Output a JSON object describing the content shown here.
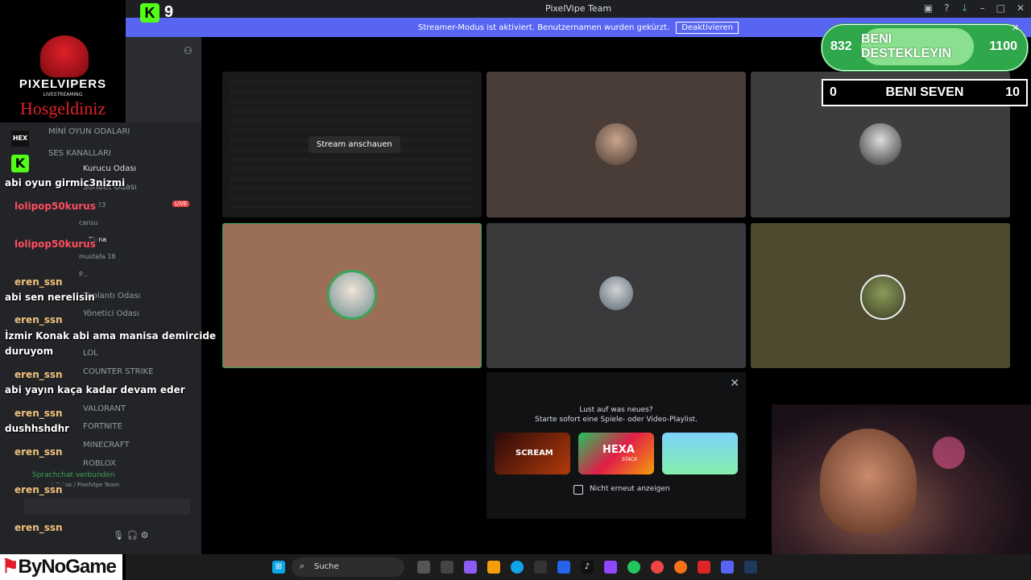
{
  "window": {
    "title": "PixelVipe Team",
    "banner_text": "Streamer-Modus ist aktiviert. Benutzernamen wurden gekürzt.",
    "banner_button": "Deaktivieren"
  },
  "overlay": {
    "kick_count": "9",
    "logo_name": "PIXELVIPERS",
    "logo_sub": "LIVESTREAMING",
    "greeting": "Hosgeldiniz",
    "brand_bottom": "ByNoGame",
    "support": {
      "left": "832",
      "label": "BENI DESTEKLEYIN",
      "right": "1100"
    },
    "loving": {
      "left": "0",
      "label": "BENI SEVEN",
      "right": "10"
    }
  },
  "sidebar": {
    "categories": [
      "MİNİ OYUN ODALARI",
      "SES KANALLARI"
    ],
    "channels": {
      "kurucu": "Kurucu Odası",
      "sohbet": "Sohbet Odası",
      "toplanti": "Toplantı Odası",
      "yonetici": "Yönetici Odası",
      "lol": "LOL",
      "cs": "COUNTER STRIKE",
      "valorant": "VALORANT",
      "fortnite": "FORTNITE",
      "minecraft": "MINECRAFT",
      "roblox": "ROBLOX"
    },
    "users": [
      "zy23",
      "cansu",
      "Elena",
      "mustafa 18",
      "P..."
    ],
    "live_badge": "LIVE",
    "voice_status": "Sprachchat verbunden",
    "voice_location": "et Odası / PixelVipe Team"
  },
  "chat": [
    {
      "type": "msg",
      "text": "abi oyun girmic3nizmi"
    },
    {
      "type": "name",
      "text": "lolipop50kurus",
      "color": "#ff4d5e"
    },
    {
      "type": "name",
      "text": "lolipop50kurus",
      "color": "#ff4d5e"
    },
    {
      "type": "name",
      "text": "eren_ssn",
      "color": "#f1c27d"
    },
    {
      "type": "msg",
      "text": "abi sen nerelisin"
    },
    {
      "type": "name",
      "text": "eren_ssn",
      "color": "#f1c27d"
    },
    {
      "type": "msg",
      "text": "İzmir Konak abi ama manisa demircide"
    },
    {
      "type": "msg",
      "text": "duruyom"
    },
    {
      "type": "name",
      "text": "eren_ssn",
      "color": "#f1c27d"
    },
    {
      "type": "msg",
      "text": "abi yayın kaça kadar devam eder"
    },
    {
      "type": "name",
      "text": "eren_ssn",
      "color": "#f1c27d"
    },
    {
      "type": "msg",
      "text": "dushhshdhr"
    },
    {
      "type": "name",
      "text": "eren_ssn",
      "color": "#f1c27d"
    },
    {
      "type": "name",
      "text": "eren_ssn",
      "color": "#f1c27d"
    },
    {
      "type": "name",
      "text": "eren_ssn",
      "color": "#f1c27d"
    }
  ],
  "stage": {
    "stream_button": "Stream anschauen",
    "tile_colors": [
      "#1a1a1a",
      "#4a3c37",
      "#3d3d3d",
      "#9a6e57",
      "#3a3a3c",
      "#4d4a30"
    ],
    "activity_title": "Lust auf was neues?",
    "activity_sub": "Starte sofort eine Spiele- oder Video-Playlist.",
    "games": [
      "SCREAM",
      "HEXA",
      "STACK"
    ],
    "checkbox_label": "Nicht erneut anzeigen"
  },
  "taskbar": {
    "search": "Suche"
  }
}
